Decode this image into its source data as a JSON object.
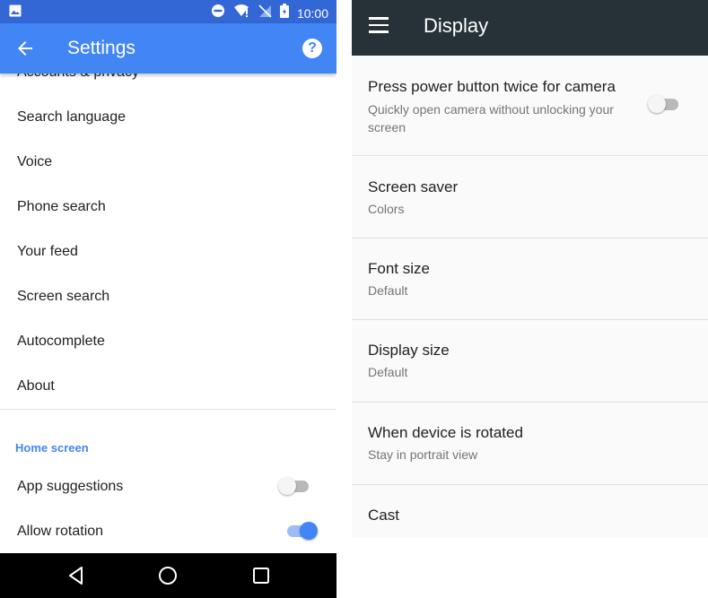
{
  "left": {
    "status_bar": {
      "time": "10:00"
    },
    "app_bar": {
      "title": "Settings",
      "help_glyph": "?"
    },
    "items": [
      {
        "label": "Accounts & privacy"
      },
      {
        "label": "Search language"
      },
      {
        "label": "Voice"
      },
      {
        "label": "Phone search"
      },
      {
        "label": "Your feed"
      },
      {
        "label": "Screen search"
      },
      {
        "label": "Autocomplete"
      },
      {
        "label": "About"
      }
    ],
    "home_screen": {
      "header": "Home screen",
      "toggles": [
        {
          "label": "App suggestions",
          "state": "off"
        },
        {
          "label": "Allow rotation",
          "state": "on"
        }
      ]
    },
    "nav_bar": {
      "icons": [
        "back-icon",
        "home-icon",
        "recents-icon"
      ]
    },
    "colors": {
      "status": "#3367d6",
      "app_bar": "#4285f4",
      "accent": "#4285f4"
    }
  },
  "right": {
    "app_bar": {
      "title": "Display"
    },
    "items": [
      {
        "title": "Press power button twice for camera",
        "subtitle": "Quickly open camera without unlocking your screen",
        "toggle": "off"
      },
      {
        "title": "Screen saver",
        "subtitle": "Colors"
      },
      {
        "title": "Font size",
        "subtitle": "Default"
      },
      {
        "title": "Display size",
        "subtitle": "Default"
      },
      {
        "title": "When device is rotated",
        "subtitle": "Stay in portrait view"
      },
      {
        "title": "Cast",
        "subtitle": ""
      }
    ],
    "colors": {
      "app_bar": "#263238"
    }
  }
}
